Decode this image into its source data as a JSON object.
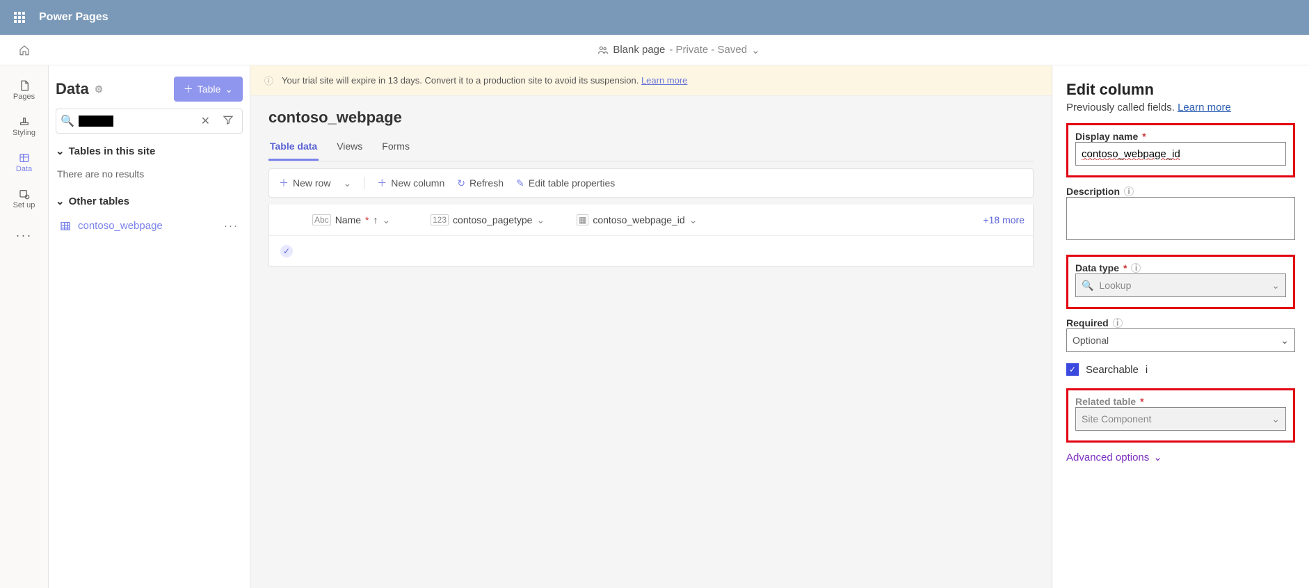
{
  "topbar": {
    "title": "Power Pages"
  },
  "subheader": {
    "page_name": "Blank page",
    "status": " - Private - Saved"
  },
  "leftrail": [
    {
      "label": "Pages",
      "name": "nav-pages"
    },
    {
      "label": "Styling",
      "name": "nav-styling"
    },
    {
      "label": "Data",
      "name": "nav-data",
      "active": true
    },
    {
      "label": "Set up",
      "name": "nav-setup"
    },
    {
      "label": "...",
      "name": "nav-more"
    }
  ],
  "sidebar": {
    "heading": "Data",
    "add_button": "Table",
    "search_placeholder": "",
    "sections": {
      "in_site": "Tables in this site",
      "no_results": "There are no results",
      "other": "Other tables"
    },
    "tables": [
      {
        "label": "contoso_webpage"
      }
    ]
  },
  "banner": {
    "text": "Your trial site will expire in 13 days. Convert it to a production site to avoid its suspension.",
    "link": "Learn more"
  },
  "content": {
    "title": "contoso_webpage",
    "tabs": [
      "Table data",
      "Views",
      "Forms"
    ],
    "toolbar": {
      "new_row": "New row",
      "new_column": "New column",
      "refresh": "Refresh",
      "edit_props": "Edit table properties"
    },
    "columns": {
      "name": "Name",
      "pagetype": "contoso_pagetype",
      "webpage_id": "contoso_webpage_id",
      "more": "+18 more"
    }
  },
  "panel": {
    "title": "Edit column",
    "subtitle_pre": "Previously called fields. ",
    "subtitle_link": "Learn more",
    "display_name_label": "Display name",
    "display_name_value": "contoso_webpage_id",
    "description_label": "Description",
    "description_value": "",
    "datatype_label": "Data type",
    "datatype_value": "Lookup",
    "required_label": "Required",
    "required_value": "Optional",
    "searchable_label": "Searchable",
    "related_label": "Related table",
    "related_value": "Site Component",
    "advanced": "Advanced options"
  }
}
